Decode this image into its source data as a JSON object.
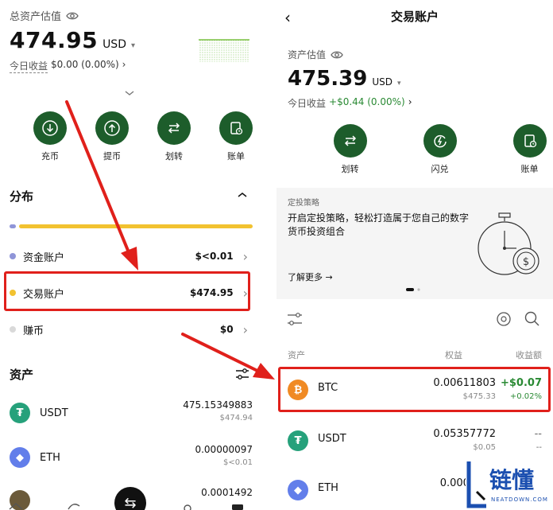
{
  "left": {
    "total_label": "总资产估值",
    "total_value": "474.95",
    "currency": "USD",
    "profit_label": "今日收益",
    "profit_value": "$0.00 (0.00%)",
    "actions": [
      {
        "label": "充币",
        "icon": "download-icon"
      },
      {
        "label": "提币",
        "icon": "upload-icon"
      },
      {
        "label": "划转",
        "icon": "transfer-icon"
      },
      {
        "label": "账单",
        "icon": "bill-icon"
      }
    ],
    "distribution_title": "分布",
    "distribution": {
      "funding_fraction": 0.0,
      "trading_fraction": 1.0
    },
    "accounts": [
      {
        "name": "资金账户",
        "amount": "$<0.01",
        "color": "#8f95d8"
      },
      {
        "name": "交易账户",
        "amount": "$474.95",
        "color": "#f2c230"
      },
      {
        "name": "赚币",
        "amount": "$0",
        "color": "#d9d9d9"
      }
    ],
    "assets_title": "资产",
    "assets": [
      {
        "symbol": "USDT",
        "qty": "475.15349883",
        "usd": "$474.94",
        "color": "#26a17b",
        "glyph": "₮"
      },
      {
        "symbol": "ETH",
        "qty": "0.00000097",
        "usd": "$<0.01",
        "color": "#627eea",
        "glyph": "◆"
      },
      {
        "symbol": "",
        "qty": "0.0001492",
        "usd": "",
        "color": "#6b5a3a",
        "glyph": ""
      }
    ]
  },
  "right": {
    "title": "交易账户",
    "value_label": "资产估值",
    "value": "475.39",
    "currency": "USD",
    "profit_label": "今日收益",
    "profit_value": "+$0.44 (0.00%)",
    "actions": [
      {
        "label": "划转",
        "icon": "transfer-icon"
      },
      {
        "label": "闪兑",
        "icon": "flash-swap-icon"
      },
      {
        "label": "账单",
        "icon": "bill-icon"
      }
    ],
    "strategy_label": "定投策略",
    "strategy_text": "开启定投策略，轻松打造属于您自己的数字货币投资组合",
    "strategy_more": "了解更多 →",
    "table_headers": {
      "asset": "资产",
      "equity": "权益",
      "pnl": "收益额"
    },
    "rows": [
      {
        "symbol": "BTC",
        "qty": "0.00611803",
        "usd": "$475.33",
        "pnl": "+$0.07",
        "pnl_pct": "+0.02%",
        "color": "#f08a24",
        "glyph": "₿"
      },
      {
        "symbol": "USDT",
        "qty": "0.05357772",
        "usd": "$0.05",
        "pnl": "--",
        "pnl_pct": "--",
        "color": "#26a17b",
        "glyph": "₮"
      },
      {
        "symbol": "ETH",
        "qty": "0.0000009",
        "usd": "",
        "pnl": "",
        "pnl_pct": "",
        "color": "#627eea",
        "glyph": "◆"
      }
    ]
  },
  "watermark": {
    "text": "链懂",
    "sub": "NEATDOWN.COM"
  },
  "colors": {
    "accent_green": "#1d5d2b",
    "highlight_red": "#e0201b",
    "positive": "#2a8a34"
  }
}
